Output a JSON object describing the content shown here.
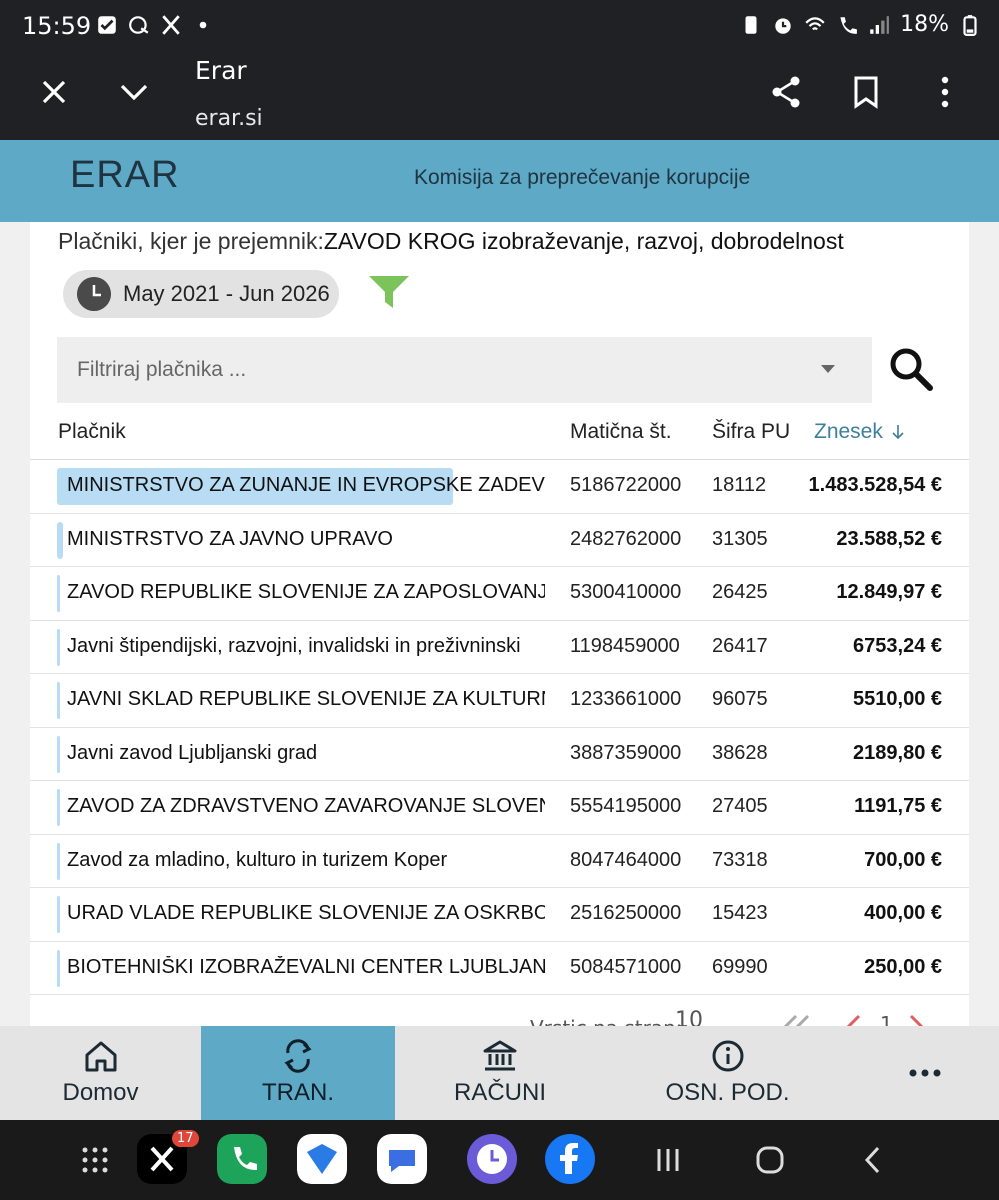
{
  "status_bar": {
    "time": "15:59",
    "battery": "18%",
    "icons": [
      "check-icon",
      "wallet-icon",
      "x-icon",
      "dot-icon",
      "battery-saver-icon",
      "alarm-icon",
      "wifi-call-icon",
      "call-icon",
      "signal-icon",
      "battery-icon"
    ]
  },
  "browser": {
    "title": "Erar",
    "url": "erar.si"
  },
  "header": {
    "logo": "ERAR",
    "subtitle": "Komisija za preprečevanje korupcije"
  },
  "main": {
    "heading_prefix": "Plačniki, kjer je prejemnik:",
    "heading_recipient": "ZAVOD KROG izobraževanje, razvoj, dobrodelnost",
    "date_range": "May 2021 - Jun 2026",
    "filter_placeholder": "Filtriraj plačnika ...",
    "columns": {
      "placnik": "Plačnik",
      "maticna": "Matična št.",
      "sifra": "Šifra PU",
      "znesek": "Znesek"
    },
    "rows": [
      {
        "name": "MINISTRSTVO ZA ZUNANJE IN EVROPSKE ZADEVE",
        "maticna": "5186722000",
        "sifra": "18112",
        "znesek": "1.483.528,54 €",
        "share": 0.98
      },
      {
        "name": "MINISTRSTVO ZA JAVNO UPRAVO",
        "maticna": "2482762000",
        "sifra": "31305",
        "znesek": "23.588,52 €",
        "share": 0.016
      },
      {
        "name": "ZAVOD REPUBLIKE SLOVENIJE ZA ZAPOSLOVANJE",
        "maticna": "5300410000",
        "sifra": "26425",
        "znesek": "12.849,97 €",
        "share": 0.008
      },
      {
        "name": "Javni štipendijski, razvojni, invalidski in preživninski",
        "maticna": "1198459000",
        "sifra": "26417",
        "znesek": "6753,24 €",
        "share": 0.0045
      },
      {
        "name": "JAVNI SKLAD REPUBLIKE SLOVENIJE ZA KULTURNE",
        "maticna": "1233661000",
        "sifra": "96075",
        "znesek": "5510,00 €",
        "share": 0.0036
      },
      {
        "name": "Javni zavod Ljubljanski grad",
        "maticna": "3887359000",
        "sifra": "38628",
        "znesek": "2189,80 €",
        "share": 0.0014
      },
      {
        "name": "ZAVOD ZA ZDRAVSTVENO ZAVAROVANJE SLOVENIJ",
        "maticna": "5554195000",
        "sifra": "27405",
        "znesek": "1191,75 €",
        "share": 0.0008
      },
      {
        "name": "Zavod za mladino, kulturo in turizem Koper",
        "maticna": "8047464000",
        "sifra": "73318",
        "znesek": "700,00 €",
        "share": 0.0005
      },
      {
        "name": "URAD VLADE REPUBLIKE SLOVENIJE ZA OSKRBO IN",
        "maticna": "2516250000",
        "sifra": "15423",
        "znesek": "400,00 €",
        "share": 0.0003
      },
      {
        "name": "BIOTEHNIŠKI IZOBRAŽEVALNI CENTER LJUBLJANA",
        "maticna": "5084571000",
        "sifra": "69990",
        "znesek": "250,00 €",
        "share": 0.0002
      }
    ],
    "pager": {
      "label": "Vrstic na stran:",
      "per_page": "10",
      "page": "1"
    }
  },
  "bottom_nav": [
    {
      "label": "Domov",
      "icon": "home-icon"
    },
    {
      "label": "TRAN.",
      "icon": "transactions-icon",
      "active": true
    },
    {
      "label": "RAČUNI",
      "icon": "bank-icon"
    },
    {
      "label": "OSN. POD.",
      "icon": "info-icon"
    },
    {
      "label": "",
      "icon": "more-horizontal-icon"
    }
  ],
  "dock": {
    "x_badge": "17",
    "apps": [
      "apps-grid-icon",
      "x-app-icon",
      "phone-app-icon",
      "mail-app-icon",
      "messages-app-icon",
      "clock-app-icon",
      "facebook-app-icon"
    ]
  },
  "colors": {
    "accent": "#5ea9c6",
    "highlight_bar": "#b8dcf4",
    "filter_funnel": "#7dc35b",
    "dark_bar": "#202124"
  }
}
